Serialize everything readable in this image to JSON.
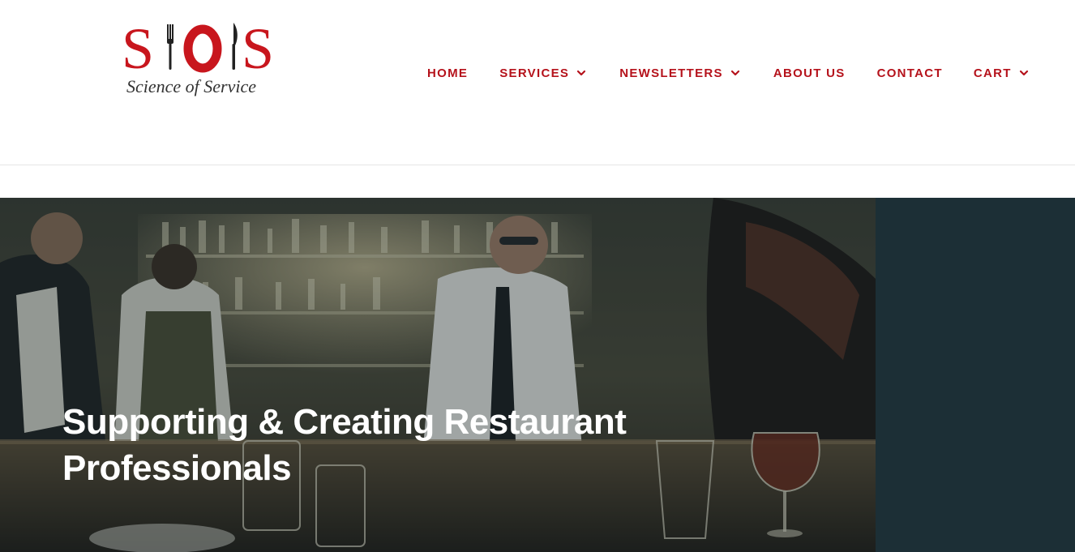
{
  "logo": {
    "letters": "SIOIS",
    "tagline": "Science of Service"
  },
  "nav": {
    "items": [
      {
        "label": "HOME",
        "dropdown": false
      },
      {
        "label": "SERVICES",
        "dropdown": true
      },
      {
        "label": "NEWSLETTERS",
        "dropdown": true
      },
      {
        "label": "ABOUT US",
        "dropdown": false
      },
      {
        "label": "CONTACT",
        "dropdown": false
      },
      {
        "label": "CART",
        "dropdown": true
      }
    ]
  },
  "hero": {
    "title_line1": "Supporting & Creating Restaurant",
    "title_line2": "Professionals",
    "photo_icon": "restaurant-bar-photo"
  },
  "colors": {
    "brand_red": "#b5121b",
    "hero_panel": "#1c2f36"
  }
}
